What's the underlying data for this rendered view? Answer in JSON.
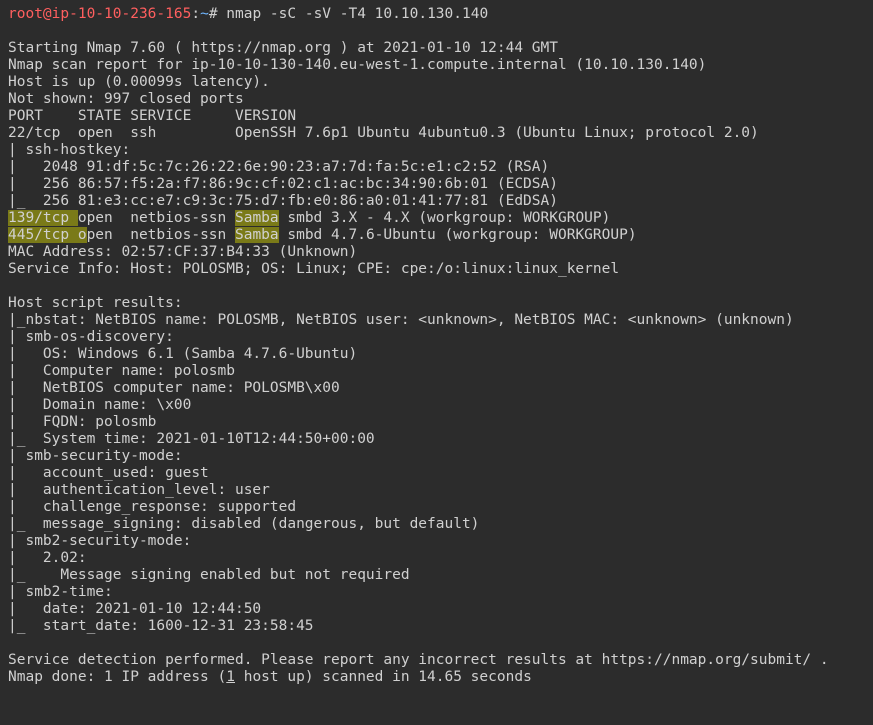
{
  "prompt": {
    "user": "root",
    "at": "@",
    "host": "ip-10-10-236-165",
    "colon": ":",
    "path": "~",
    "hash": "# "
  },
  "command": "nmap -sC -sV -T4 10.10.130.140",
  "out": {
    "l01": "Starting Nmap 7.60 ( https://nmap.org ) at 2021-01-10 12:44 GMT",
    "l02": "Nmap scan report for ip-10-10-130-140.eu-west-1.compute.internal (10.10.130.140)",
    "l03": "Host is up (0.00099s latency).",
    "l04": "Not shown: 997 closed ports",
    "l05": "PORT    STATE SERVICE     VERSION",
    "l06": "22/tcp  open  ssh         OpenSSH 7.6p1 Ubuntu 4ubuntu0.3 (Ubuntu Linux; protocol 2.0)",
    "l07": "| ssh-hostkey: ",
    "l08": "|   2048 91:df:5c:7c:26:22:6e:90:23:a7:7d:fa:5c:e1:c2:52 (RSA)",
    "l09": "|   256 86:57:f5:2a:f7:86:9c:cf:02:c1:ac:bc:34:90:6b:01 (ECDSA)",
    "l10": "|_  256 81:e3:cc:e7:c9:3c:75:d7:fb:e0:86:a0:01:41:77:81 (EdDSA)",
    "l11a": "139/tcp ",
    "l11b": "open  netbios-ssn ",
    "l11c": "Samba",
    "l11d": " smbd 3.X - 4.X (workgroup: WORKGROUP)",
    "l12a": "445/tcp o",
    "l12b": "pen  netbios-ssn ",
    "l12c": "Samba",
    "l12d": " smbd 4.7.6-Ubuntu (workgroup: WORKGROUP)",
    "l13": "MAC Address: 02:57:CF:37:B4:33 (Unknown)",
    "l14": "Service Info: Host: POLOSMB; OS: Linux; CPE: cpe:/o:linux:linux_kernel",
    "l15": "",
    "l16": "Host script results:",
    "l17": "|_nbstat: NetBIOS name: POLOSMB, NetBIOS user: <unknown>, NetBIOS MAC: <unknown> (unknown)",
    "l18": "| smb-os-discovery: ",
    "l19": "|   OS: Windows 6.1 (Samba 4.7.6-Ubuntu)",
    "l20": "|   Computer name: polosmb",
    "l21": "|   NetBIOS computer name: POLOSMB\\x00",
    "l22": "|   Domain name: \\x00",
    "l23": "|   FQDN: polosmb",
    "l24": "|_  System time: 2021-01-10T12:44:50+00:00",
    "l25": "| smb-security-mode: ",
    "l26": "|   account_used: guest",
    "l27": "|   authentication_level: user",
    "l28": "|   challenge_response: supported",
    "l29": "|_  message_signing: disabled (dangerous, but default)",
    "l30": "| smb2-security-mode: ",
    "l31": "|   2.02: ",
    "l32": "|_    Message signing enabled but not required",
    "l33": "| smb2-time: ",
    "l34": "|   date: 2021-01-10 12:44:50",
    "l35": "|_  start_date: 1600-12-31 23:58:45",
    "l36": "",
    "l37": "Service detection performed. Please report any incorrect results at https://nmap.org/submit/ .",
    "l38a": "Nmap done: 1 IP address (",
    "l38b": "1",
    "l38c": " host up) scanned in 14.65 seconds"
  }
}
